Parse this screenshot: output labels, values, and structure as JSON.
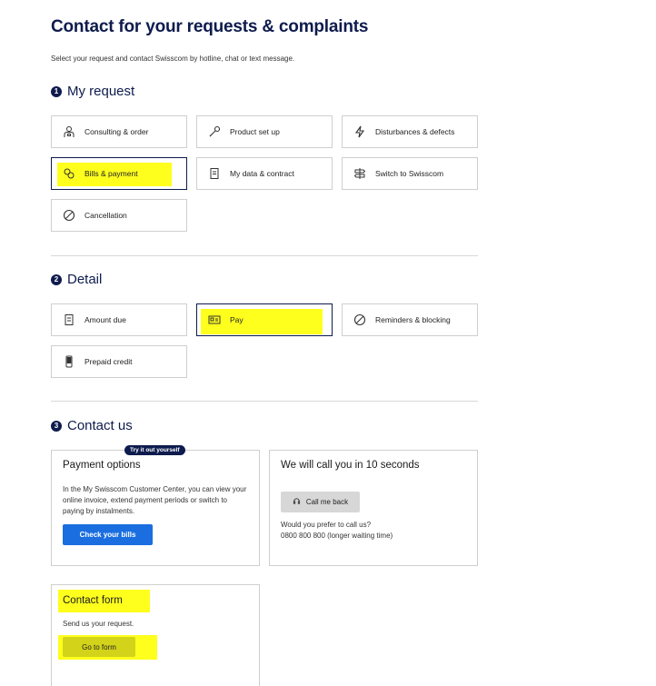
{
  "page": {
    "title": "Contact for your requests & complaints",
    "subtitle": "Select your request and contact Swisscom by hotline, chat or text message."
  },
  "sections": {
    "request": {
      "number": "1",
      "title": "My request"
    },
    "detail": {
      "number": "2",
      "title": "Detail"
    },
    "contact": {
      "number": "3",
      "title": "Contact us"
    }
  },
  "request_tiles": [
    {
      "label": "Consulting & order",
      "icon": "person-consulting-icon"
    },
    {
      "label": "Product set up",
      "icon": "wrench-icon"
    },
    {
      "label": "Disturbances & defects",
      "icon": "lightning-icon"
    },
    {
      "label": "Bills & payment",
      "icon": "coins-icon",
      "selected": true
    },
    {
      "label": "My data & contract",
      "icon": "document-icon"
    },
    {
      "label": "Switch to Swisscom",
      "icon": "signpost-icon"
    },
    {
      "label": "Cancellation",
      "icon": "cancel-circle-icon"
    }
  ],
  "detail_tiles": [
    {
      "label": "Amount due",
      "icon": "invoice-icon"
    },
    {
      "label": "Pay",
      "icon": "payment-slip-icon",
      "selected": true
    },
    {
      "label": "Reminders & blocking",
      "icon": "cancel-circle-icon"
    },
    {
      "label": "Prepaid credit",
      "icon": "phone-icon"
    }
  ],
  "contact_cards": {
    "payment": {
      "badge": "Try it out yourself",
      "title": "Payment options",
      "text": "In the My Swisscom Customer Center, you can view your online invoice, extend payment periods or switch to paying by instalments.",
      "button": "Check your bills"
    },
    "callback": {
      "title": "We will call you in 10 seconds",
      "button": "Call me back",
      "text_line1": "Would you prefer to call us?",
      "text_line2": "0800 800 800 (longer waiting time)"
    },
    "form": {
      "title": "Contact form",
      "text": "Send us your request.",
      "button": "Go to form"
    }
  },
  "colors": {
    "brand_navy": "#0e1b4d",
    "primary_button": "#1a6ee0",
    "highlight": "#ffff1e"
  }
}
